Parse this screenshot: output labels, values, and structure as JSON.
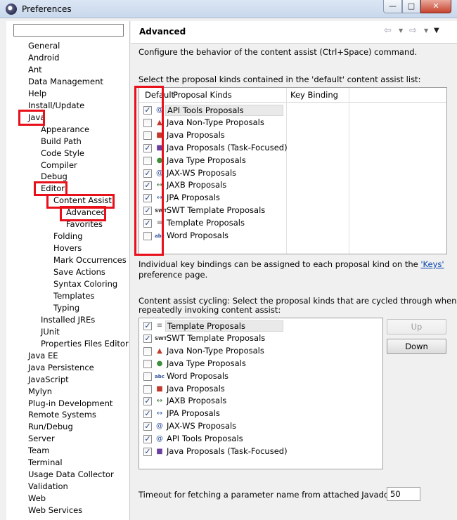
{
  "window": {
    "title": "Preferences"
  },
  "tree": {
    "filter_value": "",
    "items": [
      {
        "label": "General",
        "indent": 0
      },
      {
        "label": "Android",
        "indent": 0
      },
      {
        "label": "Ant",
        "indent": 0
      },
      {
        "label": "Data Management",
        "indent": 0
      },
      {
        "label": "Help",
        "indent": 0
      },
      {
        "label": "Install/Update",
        "indent": 0
      },
      {
        "label": "Java",
        "indent": 0
      },
      {
        "label": "Appearance",
        "indent": 1
      },
      {
        "label": "Build Path",
        "indent": 1
      },
      {
        "label": "Code Style",
        "indent": 1
      },
      {
        "label": "Compiler",
        "indent": 1
      },
      {
        "label": "Debug",
        "indent": 1
      },
      {
        "label": "Editor",
        "indent": 1
      },
      {
        "label": "Content Assist",
        "indent": 2
      },
      {
        "label": "Advanced",
        "indent": 3,
        "selected": true
      },
      {
        "label": "Favorites",
        "indent": 3
      },
      {
        "label": "Folding",
        "indent": 2
      },
      {
        "label": "Hovers",
        "indent": 2
      },
      {
        "label": "Mark Occurrences",
        "indent": 2
      },
      {
        "label": "Save Actions",
        "indent": 2
      },
      {
        "label": "Syntax Coloring",
        "indent": 2
      },
      {
        "label": "Templates",
        "indent": 2
      },
      {
        "label": "Typing",
        "indent": 2
      },
      {
        "label": "Installed JREs",
        "indent": 1
      },
      {
        "label": "JUnit",
        "indent": 1
      },
      {
        "label": "Properties Files Editor",
        "indent": 1
      },
      {
        "label": "Java EE",
        "indent": 0
      },
      {
        "label": "Java Persistence",
        "indent": 0
      },
      {
        "label": "JavaScript",
        "indent": 0
      },
      {
        "label": "Mylyn",
        "indent": 0
      },
      {
        "label": "Plug-in Development",
        "indent": 0
      },
      {
        "label": "Remote Systems",
        "indent": 0
      },
      {
        "label": "Run/Debug",
        "indent": 0
      },
      {
        "label": "Server",
        "indent": 0
      },
      {
        "label": "Team",
        "indent": 0
      },
      {
        "label": "Terminal",
        "indent": 0
      },
      {
        "label": "Usage Data Collector",
        "indent": 0
      },
      {
        "label": "Validation",
        "indent": 0
      },
      {
        "label": "Web",
        "indent": 0
      },
      {
        "label": "Web Services",
        "indent": 0
      }
    ]
  },
  "page": {
    "title": "Advanced",
    "description": "Configure the behavior of the content assist (Ctrl+Space) command.",
    "default_list_intro": "Select the proposal kinds contained in the 'default' content assist list:",
    "columns": {
      "default": "Default",
      "kinds": "Proposal Kinds",
      "binding": "Key Binding"
    },
    "default_list": [
      {
        "label": "API Tools Proposals",
        "checked": true,
        "icon": "api-tools-icon",
        "selected": true
      },
      {
        "label": "Java Non-Type Proposals",
        "checked": false,
        "icon": "java-non-type-icon"
      },
      {
        "label": "Java Proposals",
        "checked": false,
        "icon": "java-proposals-icon"
      },
      {
        "label": "Java Proposals (Task-Focused)",
        "checked": true,
        "icon": "task-focused-icon"
      },
      {
        "label": "Java Type Proposals",
        "checked": false,
        "icon": "java-type-icon"
      },
      {
        "label": "JAX-WS Proposals",
        "checked": true,
        "icon": "jax-ws-icon"
      },
      {
        "label": "JAXB Proposals",
        "checked": true,
        "icon": "jaxb-icon"
      },
      {
        "label": "JPA Proposals",
        "checked": true,
        "icon": "jpa-icon"
      },
      {
        "label": "SWT Template Proposals",
        "checked": true,
        "icon": "swt-template-icon"
      },
      {
        "label": "Template Proposals",
        "checked": true,
        "icon": "template-icon"
      },
      {
        "label": "Word Proposals",
        "checked": false,
        "icon": "word-icon"
      }
    ],
    "keys_note_before": "Individual key bindings can be assigned to each proposal kind on the ",
    "keys_link": "'Keys'",
    "keys_note_after": "preference page.",
    "cycling_intro_line1": "Content assist cycling: Select the proposal kinds that are cycled through when",
    "cycling_intro_line2": "repeatedly invoking content assist:",
    "cycling_list": [
      {
        "label": "Template Proposals",
        "checked": true,
        "icon": "template-icon",
        "selected": true
      },
      {
        "label": "SWT Template Proposals",
        "checked": true,
        "icon": "swt-template-icon"
      },
      {
        "label": "Java Non-Type Proposals",
        "checked": false,
        "icon": "java-non-type-icon"
      },
      {
        "label": "Java Type Proposals",
        "checked": false,
        "icon": "java-type-icon"
      },
      {
        "label": "Word Proposals",
        "checked": false,
        "icon": "word-icon"
      },
      {
        "label": "Java Proposals",
        "checked": false,
        "icon": "java-proposals-icon"
      },
      {
        "label": "JAXB Proposals",
        "checked": true,
        "icon": "jaxb-icon"
      },
      {
        "label": "JPA Proposals",
        "checked": true,
        "icon": "jpa-icon"
      },
      {
        "label": "JAX-WS Proposals",
        "checked": true,
        "icon": "jax-ws-icon"
      },
      {
        "label": "API Tools Proposals",
        "checked": true,
        "icon": "api-tools-icon"
      },
      {
        "label": "Java Proposals (Task-Focused)",
        "checked": true,
        "icon": "task-focused-icon"
      }
    ],
    "up_label": "Up",
    "down_label": "Down",
    "timeout_label": "Timeout for fetching a parameter name from attached Javadoc (ms):",
    "timeout_value": "50"
  },
  "colors": {
    "highlight": "#e8101a",
    "link": "#0645ad"
  }
}
